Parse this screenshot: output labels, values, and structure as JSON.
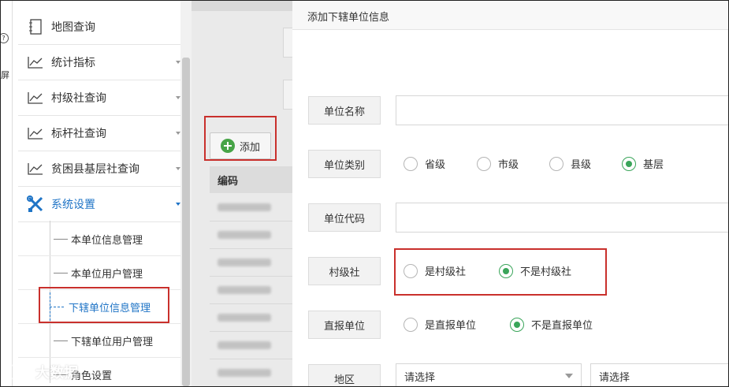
{
  "left_strip": {
    "circle_char": "?",
    "side_char": "屏"
  },
  "sidebar": {
    "items": [
      {
        "label": "地图查询",
        "icon": "notebook-icon"
      },
      {
        "label": "统计指标",
        "icon": "line-chart-icon"
      },
      {
        "label": "村级社查询",
        "icon": "line-chart-icon"
      },
      {
        "label": "标杆社查询",
        "icon": "line-chart-icon"
      },
      {
        "label": "贫困县基层社查询",
        "icon": "line-chart-icon"
      },
      {
        "label": "系统设置",
        "icon": "tools-icon"
      }
    ],
    "sub_items": [
      {
        "label": "本单位信息管理"
      },
      {
        "label": "本单位用户管理"
      },
      {
        "label": "下辖单位信息管理"
      },
      {
        "label": "下辖单位用户管理"
      },
      {
        "label": "角色设置"
      }
    ]
  },
  "main": {
    "add_button": "添加",
    "table_header": "编码"
  },
  "dialog": {
    "title": "添加下辖单位信息",
    "unit_name_label": "单位名称",
    "unit_type_label": "单位类别",
    "unit_type_options": [
      "省级",
      "市级",
      "县级",
      "基层"
    ],
    "unit_type_selected": "基层",
    "unit_code_label": "单位代码",
    "village_label": "村级社",
    "village_options": [
      "是村级社",
      "不是村级社"
    ],
    "village_selected": "不是村级社",
    "direct_label": "直报单位",
    "direct_options": [
      "是直报单位",
      "不是直报单位"
    ],
    "direct_selected": "不是直报单位",
    "region_label": "地区",
    "region_select_1": "请选择",
    "region_select_2": "请选择"
  },
  "watermark": "大数据",
  "colors": {
    "accent": "#1f74c6",
    "radio_selected": "#3aa55a",
    "highlight": "#c9302c",
    "add_icon": "#47a447"
  }
}
